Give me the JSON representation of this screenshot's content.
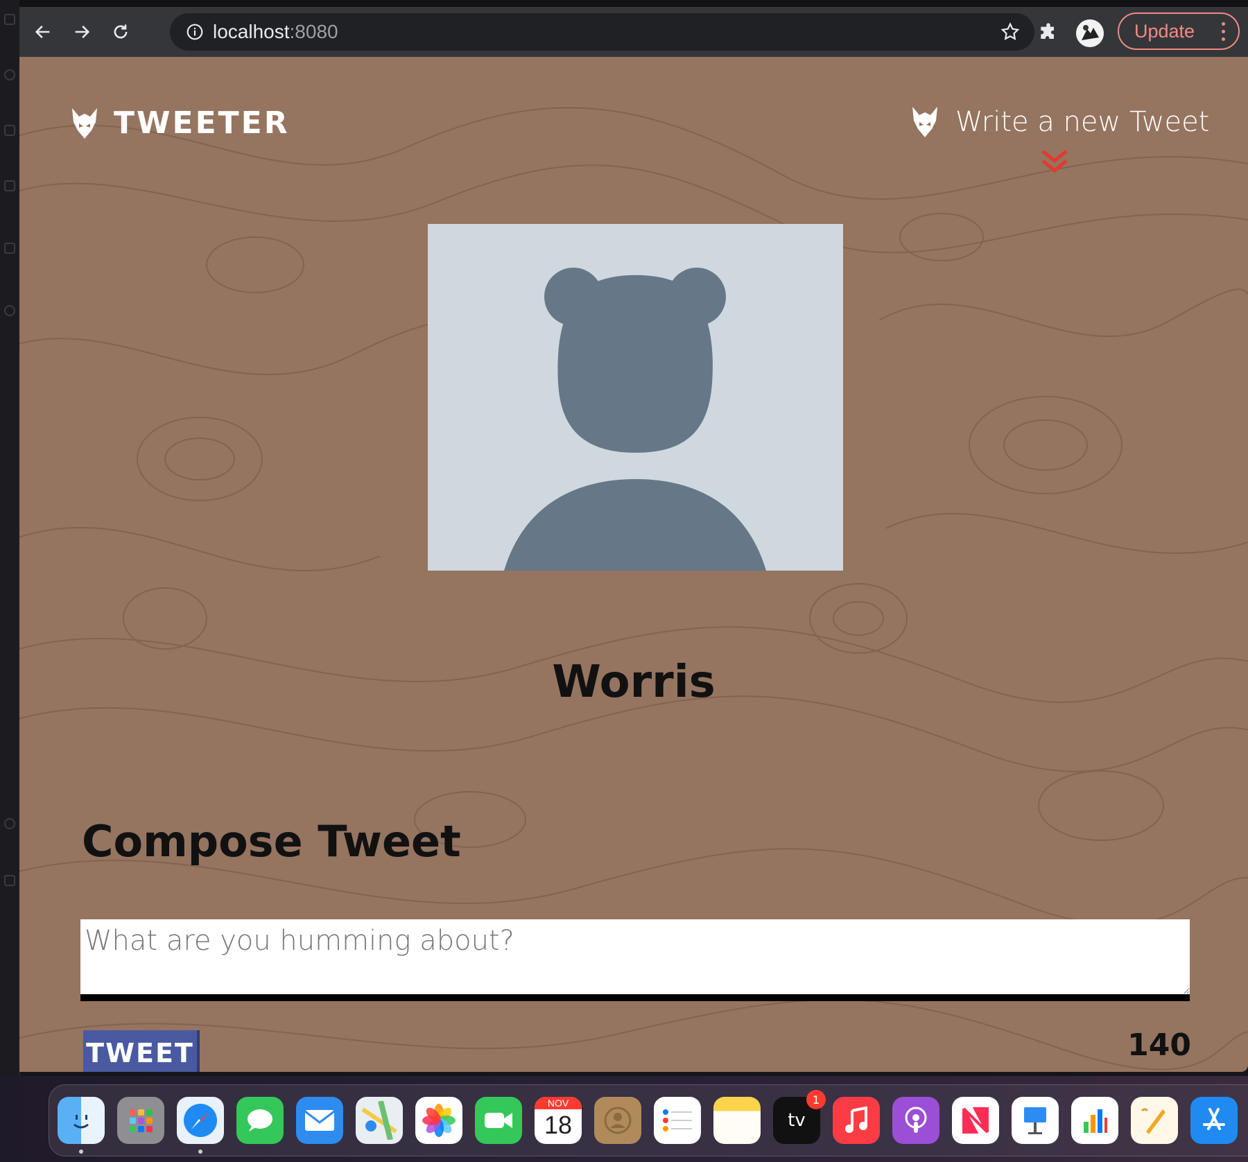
{
  "browser": {
    "url_host": "localhost",
    "url_port": ":8080",
    "update_label": "Update"
  },
  "nav": {
    "brand": "TWEETER",
    "compose_link": "Write a new Tweet"
  },
  "profile": {
    "user_name": "Worris"
  },
  "compose": {
    "title": "Compose Tweet",
    "placeholder": "What are you humming about?",
    "button_label": "TWEET",
    "char_count": "140"
  },
  "dock": {
    "calendar_month": "NOV",
    "calendar_day": "18",
    "tv_label": "tv",
    "tv_badge": "1"
  },
  "colors": {
    "page_background": "#957460",
    "accent_red": "#e23a2e",
    "button_blue": "#4a5aa1",
    "avatar_bg": "#cfd8df",
    "avatar_fg": "#667788"
  }
}
